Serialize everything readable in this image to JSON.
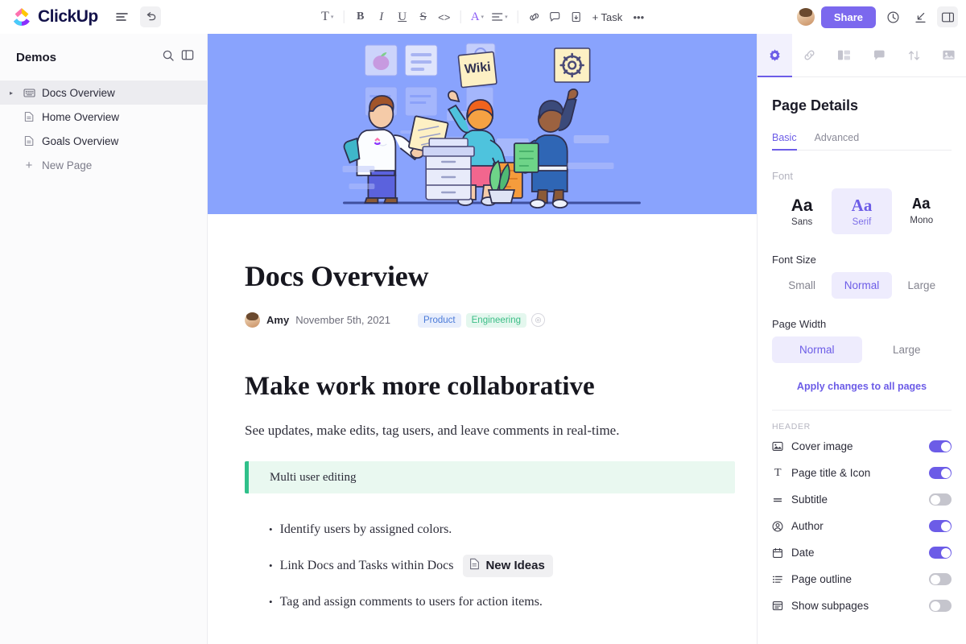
{
  "topbar": {
    "brand": "ClickUp",
    "menu_icon": "hamburger-icon",
    "undo_icon": "undo-icon",
    "share_label": "Share",
    "tools": [
      {
        "name": "text-style",
        "label": "T",
        "caret": "▾"
      },
      {
        "name": "bold",
        "label": "B"
      },
      {
        "name": "italic",
        "label": "I"
      },
      {
        "name": "underline",
        "label": "U"
      },
      {
        "name": "strikethrough",
        "label": "S"
      },
      {
        "name": "code",
        "label": "<>"
      },
      {
        "name": "text-color",
        "label": "A",
        "caret": "▾"
      },
      {
        "name": "align",
        "label": "≡",
        "caret": "▾"
      },
      {
        "name": "link",
        "label": "link-icon"
      },
      {
        "name": "comment",
        "label": "comment-icon"
      },
      {
        "name": "page",
        "label": "page-icon"
      },
      {
        "name": "add-task",
        "label": "+ Task"
      },
      {
        "name": "more",
        "label": "•••"
      }
    ]
  },
  "sidebar": {
    "title": "Demos",
    "search_icon": "search-icon",
    "collapse_icon": "collapse-panel-icon",
    "items": [
      {
        "label": "Docs Overview",
        "icon": "doc-grid-icon",
        "active": true,
        "expandable": true
      },
      {
        "label": "Home Overview",
        "icon": "page-icon",
        "active": false,
        "expandable": false
      },
      {
        "label": "Goals Overview",
        "icon": "page-icon",
        "active": false,
        "expandable": false
      },
      {
        "label": "New Page",
        "icon": "plus-icon",
        "active": false,
        "expandable": false
      }
    ]
  },
  "doc": {
    "cover_alt": "collaboration-illustration",
    "cover_color": "#89a3fd",
    "title": "Docs Overview",
    "author": "Amy",
    "date": "November 5th, 2021",
    "tags": [
      {
        "label": "Product",
        "color": "#4b7bd8"
      },
      {
        "label": "Engineering",
        "color": "#3bbd86"
      }
    ],
    "heading": "Make work more collaborative",
    "paragraph": "See updates, make edits, tag users, and leave comments in real-time.",
    "callout": "Multi user editing",
    "callout_color": "#2fc08a",
    "bullets": [
      {
        "text": "Identify users by assigned colors.",
        "chip": null
      },
      {
        "text": "Link Docs and Tasks within Docs",
        "chip": "New Ideas"
      },
      {
        "text": "Tag and assign comments to users for action items.",
        "chip": null
      }
    ],
    "wiki_card_label": "Wiki"
  },
  "panel": {
    "tabs": [
      {
        "name": "settings",
        "icon": "gear-icon",
        "active": true
      },
      {
        "name": "relationships",
        "icon": "link-icon",
        "active": false
      },
      {
        "name": "layout",
        "icon": "layout-icon",
        "active": false
      },
      {
        "name": "comments",
        "icon": "comment-icon",
        "active": false
      },
      {
        "name": "sort",
        "icon": "sort-icon",
        "active": false
      },
      {
        "name": "cover",
        "icon": "image-icon",
        "active": false
      }
    ],
    "title": "Page Details",
    "subtabs": [
      {
        "label": "Basic",
        "active": true
      },
      {
        "label": "Advanced",
        "active": false
      }
    ],
    "font_label": "Font",
    "fonts": [
      {
        "sample": "Aa",
        "name": "Sans",
        "selected": false
      },
      {
        "sample": "Aa",
        "name": "Serif",
        "selected": true
      },
      {
        "sample": "Aa",
        "name": "Mono",
        "selected": false
      }
    ],
    "font_size_label": "Font Size",
    "font_sizes": [
      {
        "label": "Small",
        "selected": false
      },
      {
        "label": "Normal",
        "selected": true
      },
      {
        "label": "Large",
        "selected": false
      }
    ],
    "page_width_label": "Page Width",
    "page_widths": [
      {
        "label": "Normal",
        "selected": true
      },
      {
        "label": "Large",
        "selected": false
      }
    ],
    "apply_link": "Apply changes to all pages",
    "header_label": "HEADER",
    "options": [
      {
        "label": "Cover image",
        "icon": "image-icon",
        "on": true
      },
      {
        "label": "Page title & Icon",
        "icon": "title-icon",
        "on": true
      },
      {
        "label": "Subtitle",
        "icon": "subtitle-icon",
        "on": false
      },
      {
        "label": "Author",
        "icon": "person-icon",
        "on": true
      },
      {
        "label": "Date",
        "icon": "calendar-icon",
        "on": true
      },
      {
        "label": "Page outline",
        "icon": "outline-icon",
        "on": false
      },
      {
        "label": "Show subpages",
        "icon": "subpages-icon",
        "on": false
      }
    ],
    "accent_color": "#6c5ce7"
  }
}
